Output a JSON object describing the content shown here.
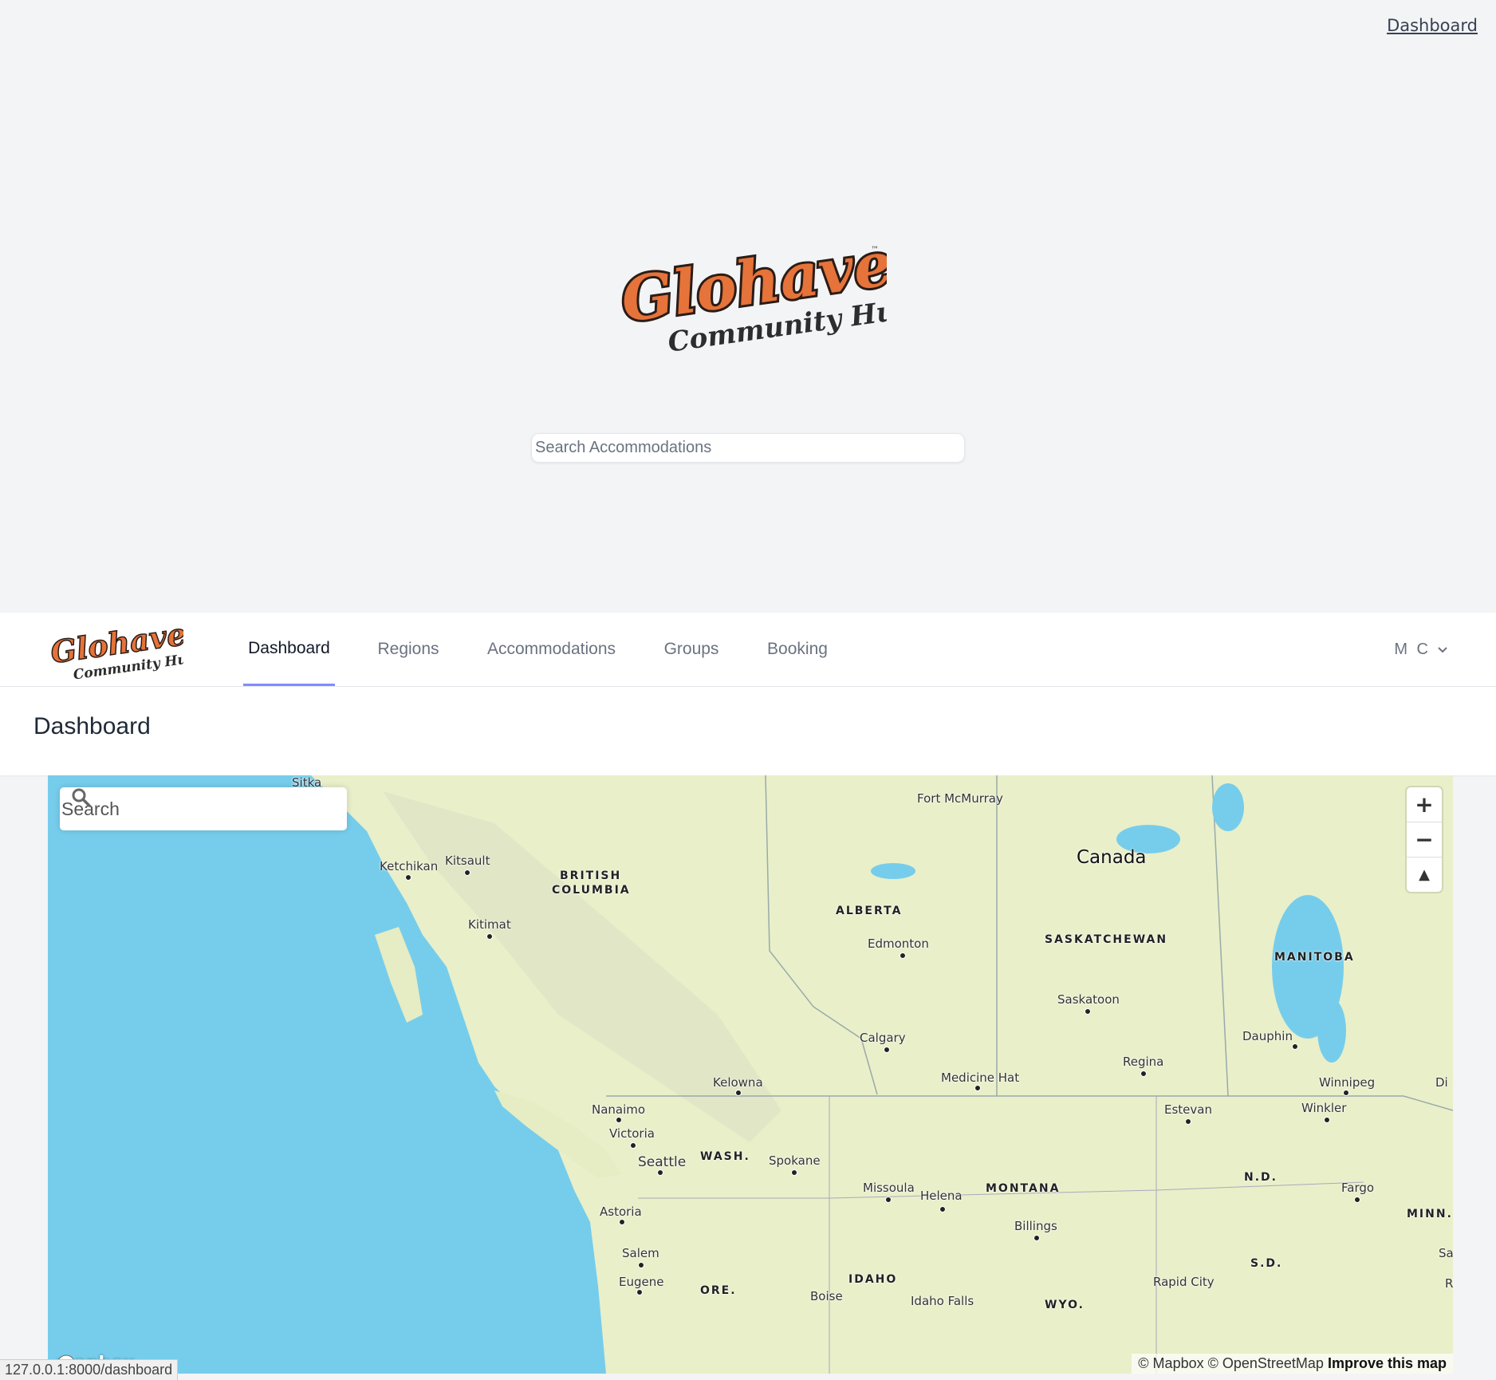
{
  "top_nav": {
    "dashboard_link": "Dashboard"
  },
  "hero": {
    "logo_text": "Glohaven",
    "logo_sub": "Community Hub",
    "logo_tm": "™",
    "search_placeholder": "Search Accommodations"
  },
  "navbar": {
    "tabs": [
      {
        "label": "Dashboard",
        "active": true
      },
      {
        "label": "Regions",
        "active": false
      },
      {
        "label": "Accommodations",
        "active": false
      },
      {
        "label": "Groups",
        "active": false
      },
      {
        "label": "Booking",
        "active": false
      }
    ],
    "user_initials": "M C",
    "accent_color": "#818cf8"
  },
  "page": {
    "title": "Dashboard"
  },
  "map": {
    "search_placeholder": "Search",
    "controls": {
      "zoom_in": "+",
      "zoom_out": "−",
      "compass": "▲"
    },
    "country_label": "Canada",
    "provinces": [
      "BRITISH",
      "COLUMBIA",
      "ALBERTA",
      "SASKATCHEWAN",
      "MANITOBA",
      "WASH.",
      "MONTANA",
      "N.D.",
      "MINN.",
      "S.D.",
      "IDAHO",
      "ORE.",
      "WYO."
    ],
    "cities": [
      "Sitka",
      "Fort McMurray",
      "Ketchikan",
      "Kitsault",
      "Kitimat",
      "Edmonton",
      "Saskatoon",
      "Calgary",
      "Dauphin",
      "Regina",
      "Medicine Hat",
      "Kelowna",
      "Winnipeg",
      "Nanaimo",
      "Estevan",
      "Winkler",
      "Victoria",
      "Seattle",
      "Spokane",
      "Missoula",
      "Helena",
      "Fargo",
      "Astoria",
      "Billings",
      "Salem",
      "Eugene",
      "Boise",
      "Idaho Falls",
      "Rapid City",
      "Di",
      "Saint",
      "R"
    ],
    "mapbox_logo": "mapbox",
    "attribution": "© Mapbox © OpenStreetMap",
    "improve": "Improve this map",
    "water_color": "#76cdeb",
    "land_color": "#e9efc9"
  },
  "status_bar": {
    "url": "127.0.0.1:8000/dashboard"
  }
}
